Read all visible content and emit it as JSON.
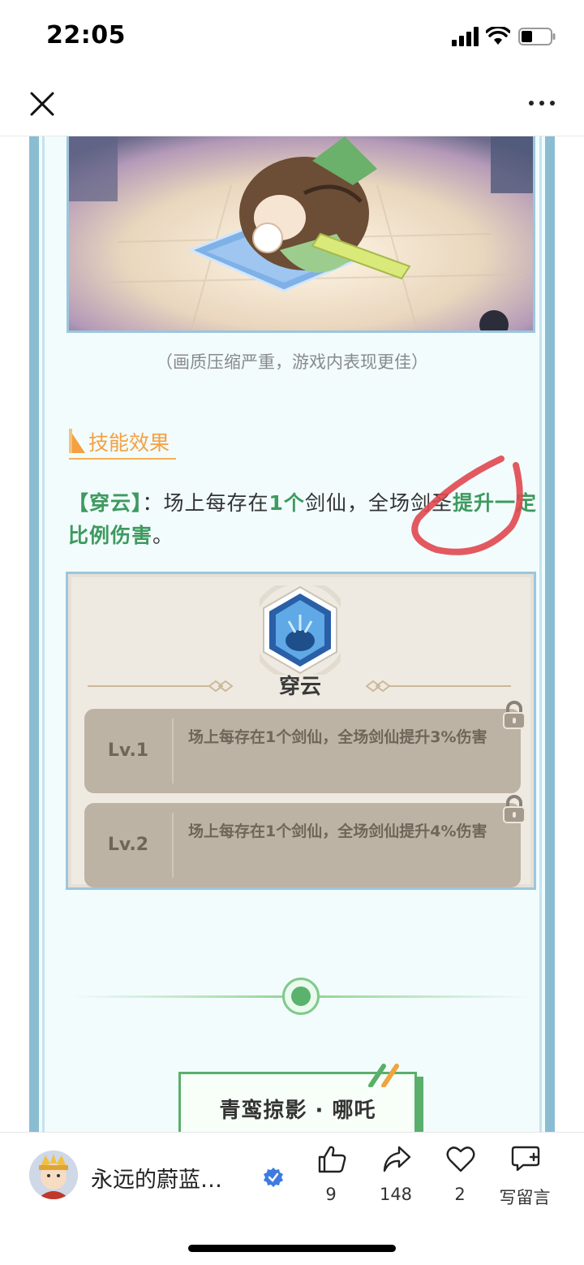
{
  "status_bar": {
    "time": "22:05",
    "icons": [
      "signal-icon",
      "wifi-icon",
      "battery-icon"
    ]
  },
  "nav": {
    "icons": [
      "close-icon",
      "more-icon"
    ]
  },
  "article": {
    "image_caption": "（画质压缩严重，游戏内表现更佳）",
    "section_title": "技能效果",
    "skill_desc": {
      "p1": "【穿云】",
      "p2": "：场上每存在",
      "p3": "1个",
      "p4": "剑仙，全场剑圣",
      "p5": "提升一定比例伤害",
      "p6": "。"
    },
    "skill_card": {
      "name": "穿云",
      "levels": [
        {
          "label": "Lv.1",
          "text": "场上每存在1个剑仙，全场剑仙提升3%伤害"
        },
        {
          "label": "Lv.2",
          "text": "场上每存在1个剑仙，全场剑仙提升4%伤害"
        }
      ]
    },
    "next_section_title": "青鸾掠影 · 哪吒"
  },
  "bottom_bar": {
    "author": "永远的蔚蓝…",
    "like_count": "9",
    "share_count": "148",
    "favorite_count": "2",
    "comment_label": "写留言"
  },
  "colors": {
    "frame_border": "#8bbdd2",
    "accent_orange": "#f5a041",
    "accent_green": "#3e9a5f",
    "annotation_red": "#e0474f"
  }
}
